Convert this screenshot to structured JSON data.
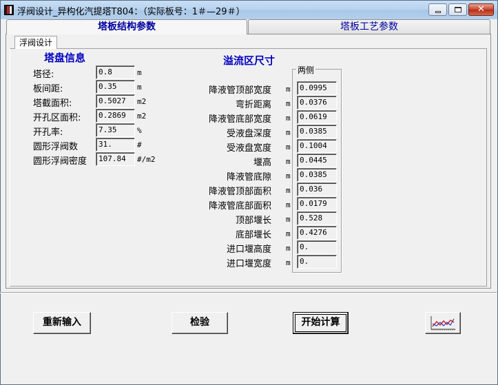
{
  "window": {
    "title": "浮阀设计_异构化汽提塔T804：（实际板号：1＃—29＃）",
    "controls": {
      "minimize": "",
      "maximize": "",
      "close": "✕"
    }
  },
  "tabs": [
    {
      "label": "塔板结构参数",
      "active": true
    },
    {
      "label": "塔板工艺参数",
      "active": false
    }
  ],
  "subtab": {
    "label": "浮阀设计"
  },
  "tray_info": {
    "title": "塔盘信息",
    "rows": [
      {
        "label": "塔径:",
        "value": "0.8",
        "unit": "m"
      },
      {
        "label": "板间距:",
        "value": "0.35",
        "unit": "m"
      },
      {
        "label": "塔截面积:",
        "value": "0.5027",
        "unit": "m2"
      },
      {
        "label": "开孔区面积:",
        "value": "0.2869",
        "unit": "m2"
      },
      {
        "label": "开孔率:",
        "value": "7.35",
        "unit": "%"
      },
      {
        "label": "圆形浮阀数",
        "value": "31.",
        "unit": "#"
      },
      {
        "label": "圆形浮阀密度",
        "value": "107.84",
        "unit": "#/m2"
      }
    ]
  },
  "overflow": {
    "title": "溢流区尺寸",
    "group_label": "两侧",
    "rows": [
      {
        "label": "降液管顶部宽度",
        "unit": "m",
        "value": "0.0995"
      },
      {
        "label": "弯折距离",
        "unit": "m",
        "value": "0.0376"
      },
      {
        "label": "降液管底部宽度",
        "unit": "m",
        "value": "0.0619"
      },
      {
        "label": "受液盘深度",
        "unit": "m",
        "value": "0.0385"
      },
      {
        "label": "受液盘宽度",
        "unit": "m",
        "value": "0.1004"
      },
      {
        "label": "堰高",
        "unit": "m",
        "value": "0.0445"
      },
      {
        "label": "降液管底隙",
        "unit": "m",
        "value": "0.0385"
      },
      {
        "label": "降液管顶部面积",
        "unit": "m",
        "value": "0.036"
      },
      {
        "label": "降液管底部面积",
        "unit": "m",
        "value": "0.0179"
      },
      {
        "label": "顶部堰长",
        "unit": "m",
        "value": "0.528"
      },
      {
        "label": "底部堰长",
        "unit": "m",
        "value": "0.4276"
      },
      {
        "label": "进口堰高度",
        "unit": "m",
        "value": "0."
      },
      {
        "label": "进口堰宽度",
        "unit": "m",
        "value": "0."
      }
    ]
  },
  "buttons": {
    "reset": "重新输入",
    "check": "检验",
    "calculate": "开始计算",
    "chart_icon": "line-chart-icon"
  },
  "colors": {
    "accent_text": "#0000c0",
    "chart_line_red": "#e02020",
    "chart_line_blue": "#2040c0"
  }
}
